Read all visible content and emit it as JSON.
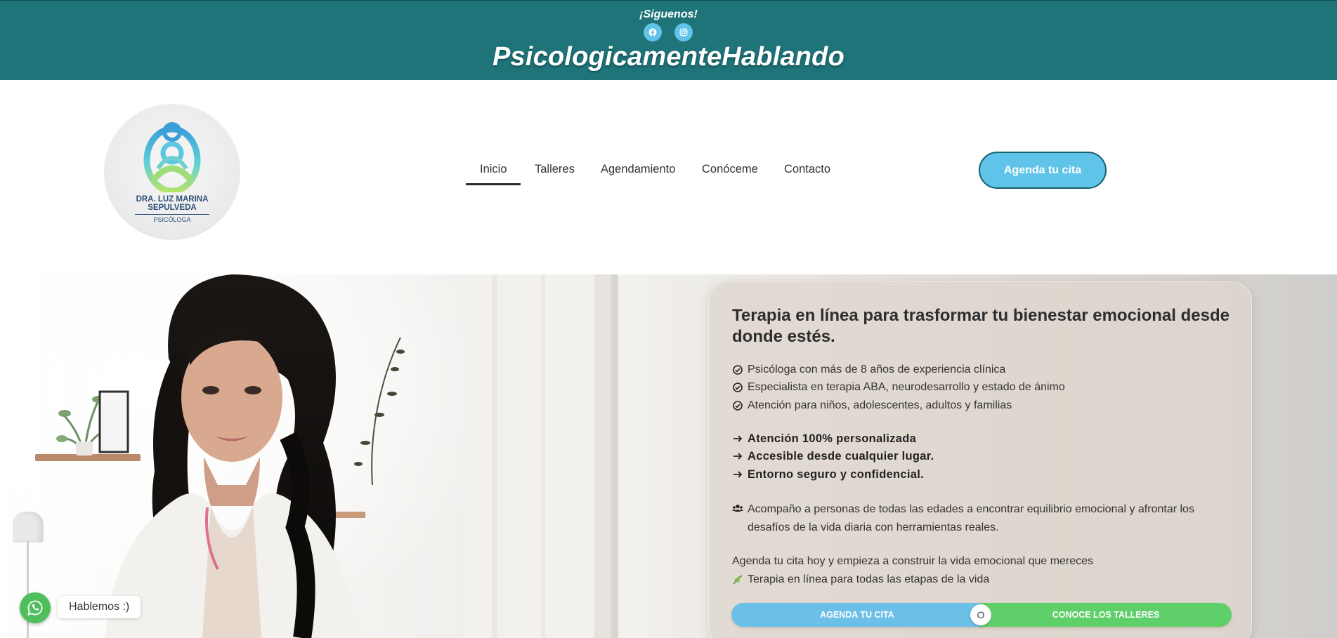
{
  "topbar": {
    "follow_label": "¡Siguenos!",
    "social_icons": [
      "facebook-icon",
      "instagram-icon"
    ],
    "brand_title": "PsicologicamenteHablando",
    "color": "#1e7479"
  },
  "logo": {
    "line1": "DRA. LUZ MARINA",
    "line2": "SEPULVEDA",
    "line3": "PSICÓLOGA"
  },
  "nav": {
    "items": [
      "Inicio",
      "Talleres",
      "Agendamiento",
      "Conóceme",
      "Contacto"
    ],
    "active": "Inicio",
    "cta": "Agenda tu cita"
  },
  "hero": {
    "title": "Terapia en línea para trasformar tu bienestar emocional desde donde estés.",
    "checks": [
      "Psicóloga con más de 8 años de experiencia clínica",
      "Especialista en terapia ABA, neurodesarrollo y estado de ánimo",
      "Atención para niños, adolescentes, adultos y familias"
    ],
    "arrows": [
      "Atención 100% personalizada",
      "Accesible desde cualquier lugar.",
      "Entorno seguro y confidencial."
    ],
    "paragraph": "Acompaño a personas de todas las edades a encontrar equilibrio emocional y afrontar los desafíos de la vida diaria con herramientas reales.",
    "agenda_line": "Agenda tu cita hoy y empieza a construir la vida emocional que mereces",
    "leaf_line": "Terapia en línea para todas las etapas de la vida",
    "button_primary": "AGENDA TU CITA",
    "separator": "O",
    "button_secondary": "CONOCE LOS TALLERES",
    "colors": {
      "blue": "#6cbfe6",
      "green": "#5fcf6a"
    }
  },
  "whatsapp": {
    "label": "Hablemos :)",
    "color": "#4fbe5c"
  }
}
